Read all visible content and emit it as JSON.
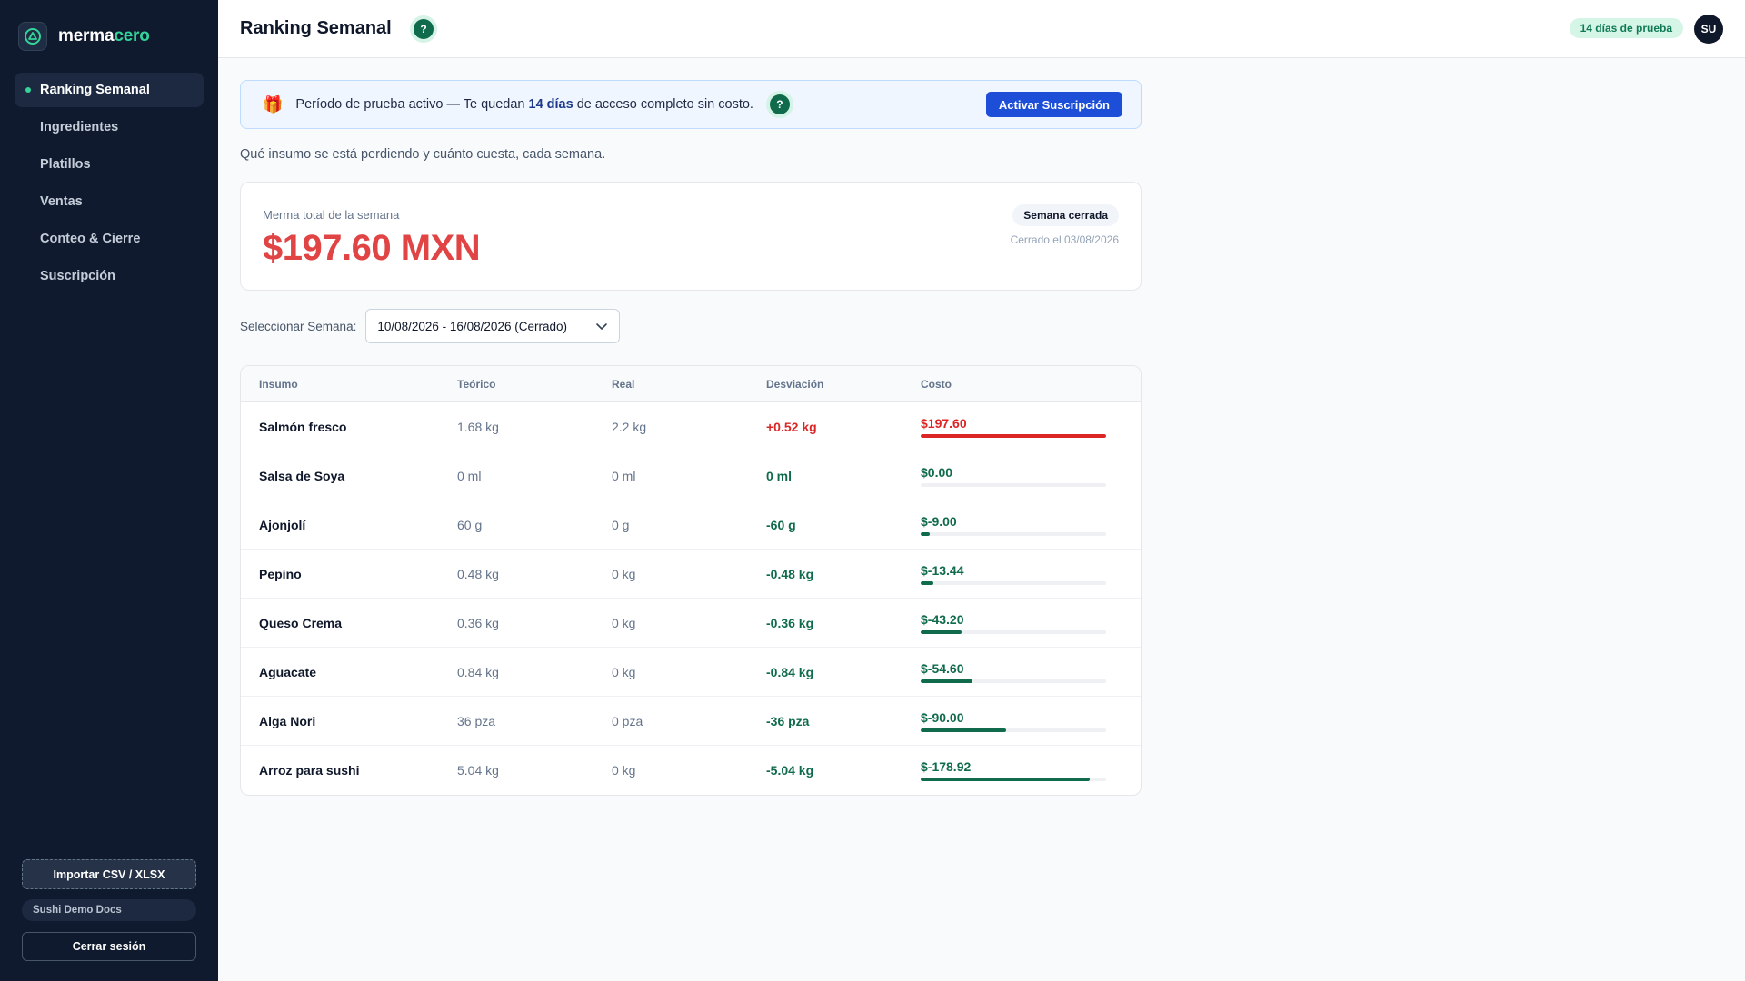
{
  "brand": {
    "name_part1": "merma",
    "name_part2": "cero"
  },
  "sidebar": {
    "items": [
      {
        "label": "Ranking Semanal",
        "active": true
      },
      {
        "label": "Ingredientes",
        "active": false
      },
      {
        "label": "Platillos",
        "active": false
      },
      {
        "label": "Ventas",
        "active": false
      },
      {
        "label": "Conteo & Cierre",
        "active": false
      },
      {
        "label": "Suscripción",
        "active": false
      }
    ],
    "import_label": "Importar CSV / XLSX",
    "org_name": "Sushi Demo Docs",
    "logout_label": "Cerrar sesión"
  },
  "header": {
    "title": "Ranking Semanal",
    "help_glyph": "?",
    "trial_badge": "14 días de prueba",
    "avatar_initials": "SU"
  },
  "banner": {
    "icon": "🎁",
    "text_before": "Período de prueba activo — Te quedan ",
    "text_bold": "14 días",
    "text_after": " de acceso completo sin costo.",
    "button_label": "Activar Suscripción"
  },
  "subtitle": "Qué insumo se está perdiendo y cuánto cuesta, cada semana.",
  "summary": {
    "label": "Merma total de la semana",
    "value": "$197.60 MXN",
    "badge": "Semana cerrada",
    "closed_text": "Cerrado el 03/08/2026"
  },
  "week_selector": {
    "label": "Seleccionar Semana:",
    "value": "10/08/2026 - 16/08/2026 (Cerrado)"
  },
  "table": {
    "headers": [
      "Insumo",
      "Teórico",
      "Real",
      "Desviación",
      "Costo"
    ],
    "rows": [
      {
        "insumo": "Salmón fresco",
        "teorico": "1.68 kg",
        "real": "2.2 kg",
        "desviacion": "+0.52 kg",
        "costo": "$197.60",
        "bar": 1.0,
        "positive": true
      },
      {
        "insumo": "Salsa de Soya",
        "teorico": "0 ml",
        "real": "0 ml",
        "desviacion": "0 ml",
        "costo": "$0.00",
        "bar": 0.0,
        "positive": false
      },
      {
        "insumo": "Ajonjolí",
        "teorico": "60 g",
        "real": "0 g",
        "desviacion": "-60 g",
        "costo": "$-9.00",
        "bar": 0.05,
        "positive": false
      },
      {
        "insumo": "Pepino",
        "teorico": "0.48 kg",
        "real": "0 kg",
        "desviacion": "-0.48 kg",
        "costo": "$-13.44",
        "bar": 0.07,
        "positive": false
      },
      {
        "insumo": "Queso Crema",
        "teorico": "0.36 kg",
        "real": "0 kg",
        "desviacion": "-0.36 kg",
        "costo": "$-43.20",
        "bar": 0.22,
        "positive": false
      },
      {
        "insumo": "Aguacate",
        "teorico": "0.84 kg",
        "real": "0 kg",
        "desviacion": "-0.84 kg",
        "costo": "$-54.60",
        "bar": 0.28,
        "positive": false
      },
      {
        "insumo": "Alga Nori",
        "teorico": "36 pza",
        "real": "0 pza",
        "desviacion": "-36 pza",
        "costo": "$-90.00",
        "bar": 0.46,
        "positive": false
      },
      {
        "insumo": "Arroz para sushi",
        "teorico": "5.04 kg",
        "real": "0 kg",
        "desviacion": "-5.04 kg",
        "costo": "$-178.92",
        "bar": 0.91,
        "positive": false
      }
    ]
  },
  "colors": {
    "loss": "#dc2626",
    "saving": "#0f6b4c",
    "accent": "#34d399",
    "primary_button": "#1d4ed8"
  }
}
